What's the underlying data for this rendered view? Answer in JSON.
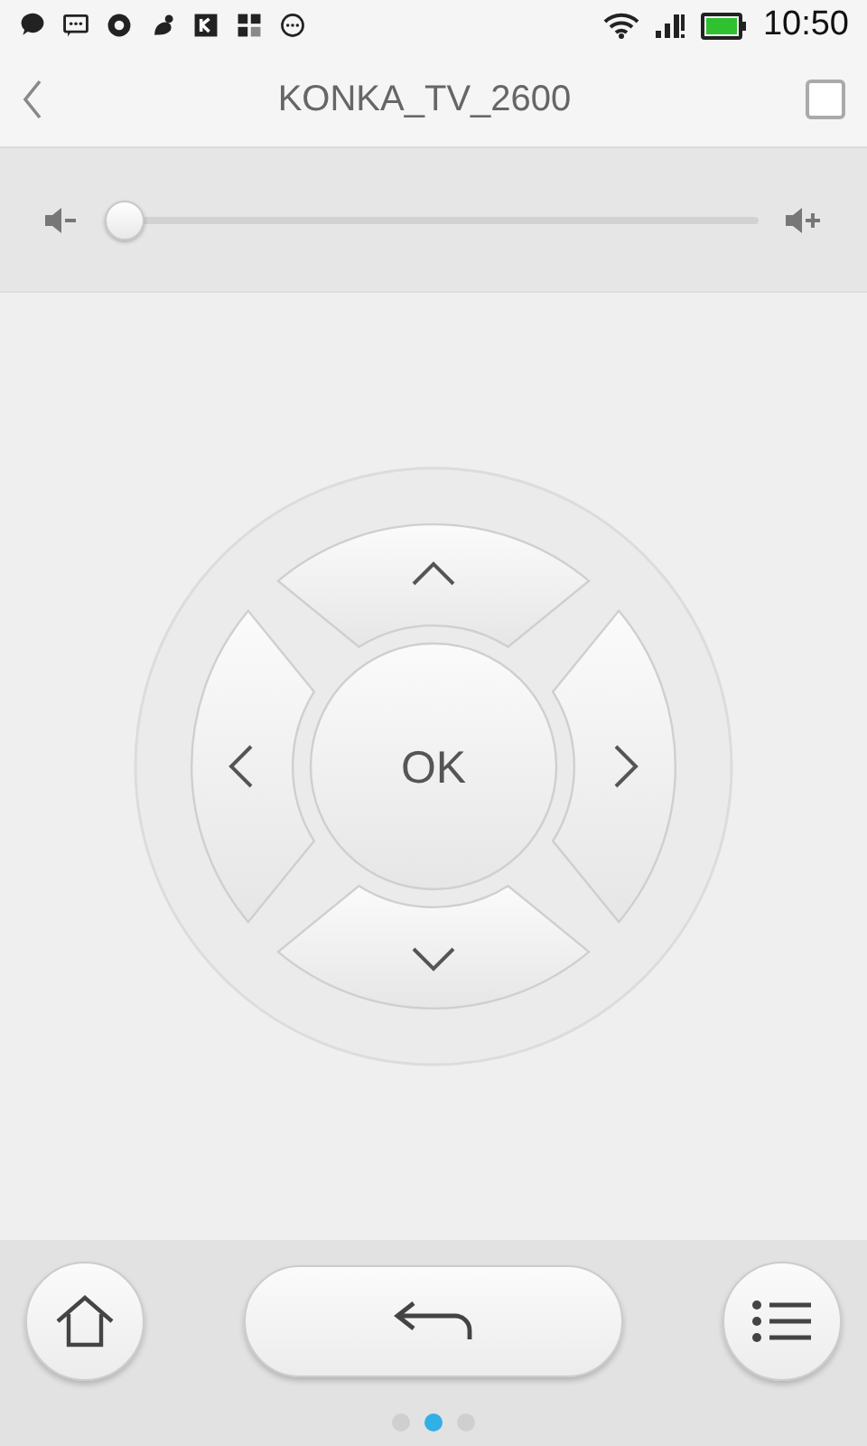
{
  "status_bar": {
    "time": "10:50"
  },
  "header": {
    "title": "KONKA_TV_2600",
    "checkbox": {
      "checked": false
    }
  },
  "volume": {
    "level": 0.0
  },
  "dpad": {
    "ok_label": "OK"
  },
  "pager": [
    {
      "selected": false
    },
    {
      "selected": true
    },
    {
      "selected": false
    }
  ]
}
